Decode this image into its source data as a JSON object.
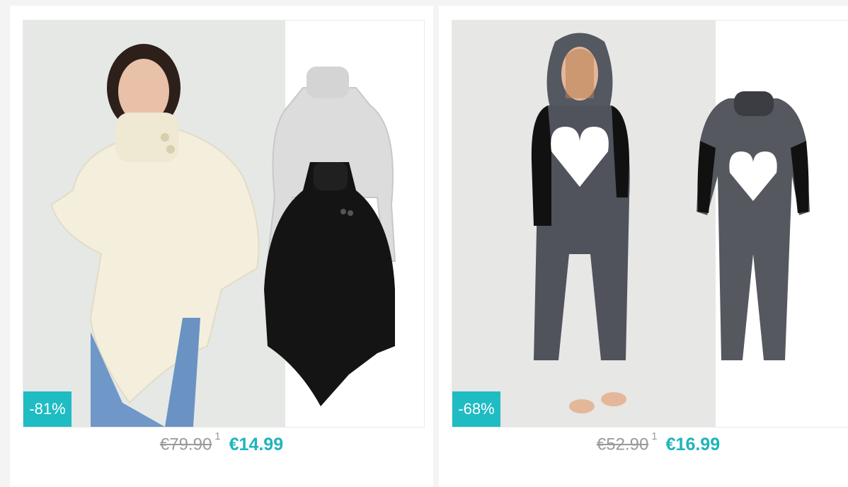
{
  "products": [
    {
      "discount": "-81%",
      "old_price": "€79.90",
      "footnote": "1",
      "new_price": "€14.99",
      "image_icon": "poncho-sweater-image"
    },
    {
      "discount": "-68%",
      "old_price": "€52.90",
      "footnote": "1",
      "new_price": "€16.99",
      "image_icon": "onesie-pajama-image"
    }
  ],
  "colors": {
    "accent": "#1fbcc3",
    "price_accent": "#1fb4bb",
    "old_price": "#9a9a9a",
    "background": "#f4f4f4"
  }
}
